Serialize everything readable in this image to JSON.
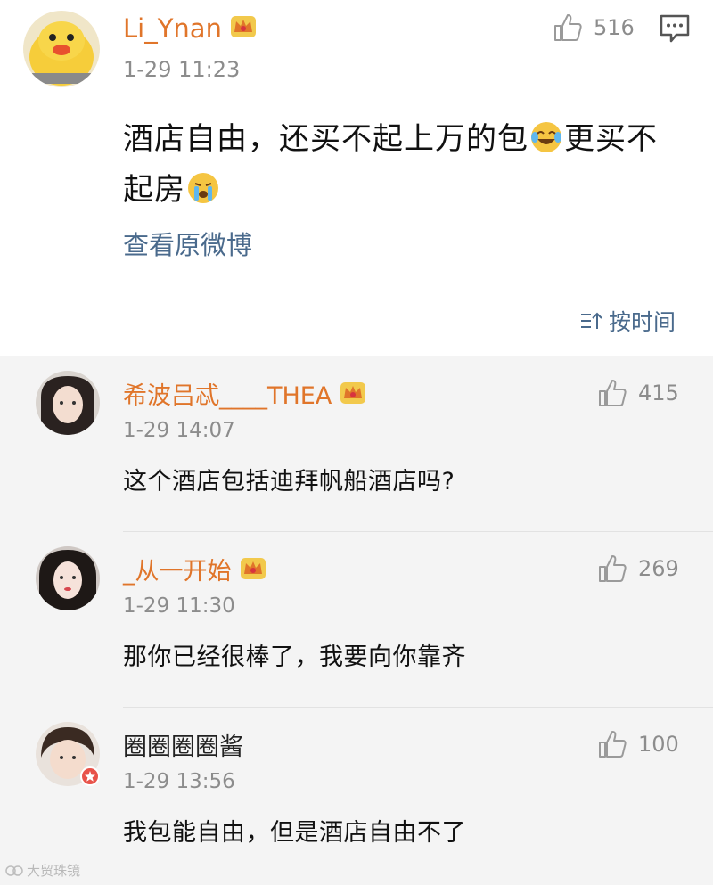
{
  "post": {
    "username": "Li_Ynan",
    "time": "1-29 11:23",
    "likes": "516",
    "body_line1_a": "酒店自由，还买不起上万的包",
    "body_line1_b": "更买不",
    "body_line2": "起房",
    "emoji_1": "laugh-cry-emoji",
    "emoji_2": "crying-emoji",
    "view_original": "查看原微博",
    "sort_label": "按时间"
  },
  "comments": [
    {
      "username": "希波吕忒____THEA",
      "vip": true,
      "time": "1-29 14:07",
      "text": "这个酒店包括迪拜帆船酒店吗?",
      "likes": "415"
    },
    {
      "username": "_从一开始",
      "vip": true,
      "time": "1-29 11:30",
      "text": "那你已经很棒了，我要向你靠齐",
      "likes": "269"
    },
    {
      "username": "圈圈圈圈酱",
      "vip": false,
      "time": "1-29 13:56",
      "text": "我包能自由，但是酒店自由不了",
      "likes": "100"
    }
  ],
  "watermark": "大贸珠镜",
  "colors": {
    "username": "#e0752a",
    "link": "#4a6a8c",
    "time": "#8c8c8c",
    "list_bg": "#f4f4f4"
  }
}
